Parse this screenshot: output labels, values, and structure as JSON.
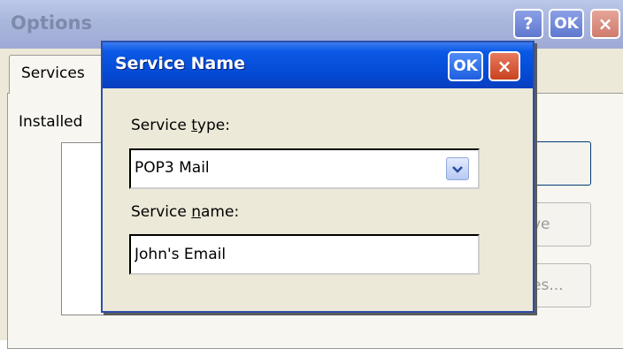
{
  "options_window": {
    "title": "Options",
    "help_button": "?",
    "ok_button": "OK",
    "close_button": "×",
    "tab": "Services",
    "installed_label": "Installed",
    "buttons": {
      "add": ".",
      "remove": "ve",
      "properties": "es..."
    }
  },
  "service_dialog": {
    "title": "Service Name",
    "ok_button": "OK",
    "close_button": "×",
    "service_type_label_pre": "Service ",
    "service_type_label_u": "t",
    "service_type_label_post": "ype:",
    "service_type_value": "POP3 Mail",
    "service_name_label_pre": "Service ",
    "service_name_label_u": "n",
    "service_name_label_post": "ame:",
    "service_name_value": "John's Email"
  },
  "icons": {
    "dropdown": "chevron-down-icon"
  },
  "colors": {
    "title_active": "#0449d3",
    "close_red": "#c8431f",
    "face": "#ece9d8"
  }
}
